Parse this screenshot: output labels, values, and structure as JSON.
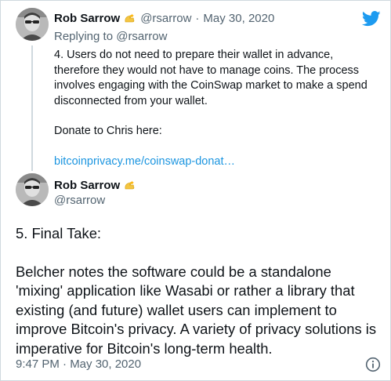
{
  "colors": {
    "link": "#1b95e0",
    "muted": "#536471",
    "text": "#0f1419",
    "twitter_blue": "#1d9bf0",
    "border": "#cfd9de"
  },
  "parent_tweet": {
    "author_name": "Rob Sarrow",
    "badge_icon": "star-hand-emoji-icon",
    "handle": "@rsarrow",
    "separator": "·",
    "date": "May 30, 2020",
    "replying_to": "Replying to @rsarrow",
    "text": "4. Users do not need to prepare their wallet in advance, therefore they would not have to manage coins. The process involves engaging with the CoinSwap market to make a spend disconnected from your wallet.",
    "donate_text": "Donate to Chris here:",
    "link_text": "bitcoinprivacy.me/coinswap-donat…"
  },
  "main_tweet": {
    "author_name": "Rob Sarrow",
    "badge_icon": "star-hand-emoji-icon",
    "handle": "@rsarrow",
    "heading": "5. Final Take:",
    "text": "Belcher notes the software could be a standalone 'mixing' application like Wasabi or rather a library that existing (and future) wallet users can implement to improve Bitcoin's privacy. A variety of privacy solutions is imperative for Bitcoin's long-term health.",
    "timestamp": "9:47 PM · May 30, 2020"
  },
  "icons": {
    "brand": "twitter-bird-icon",
    "info": "info-icon"
  }
}
